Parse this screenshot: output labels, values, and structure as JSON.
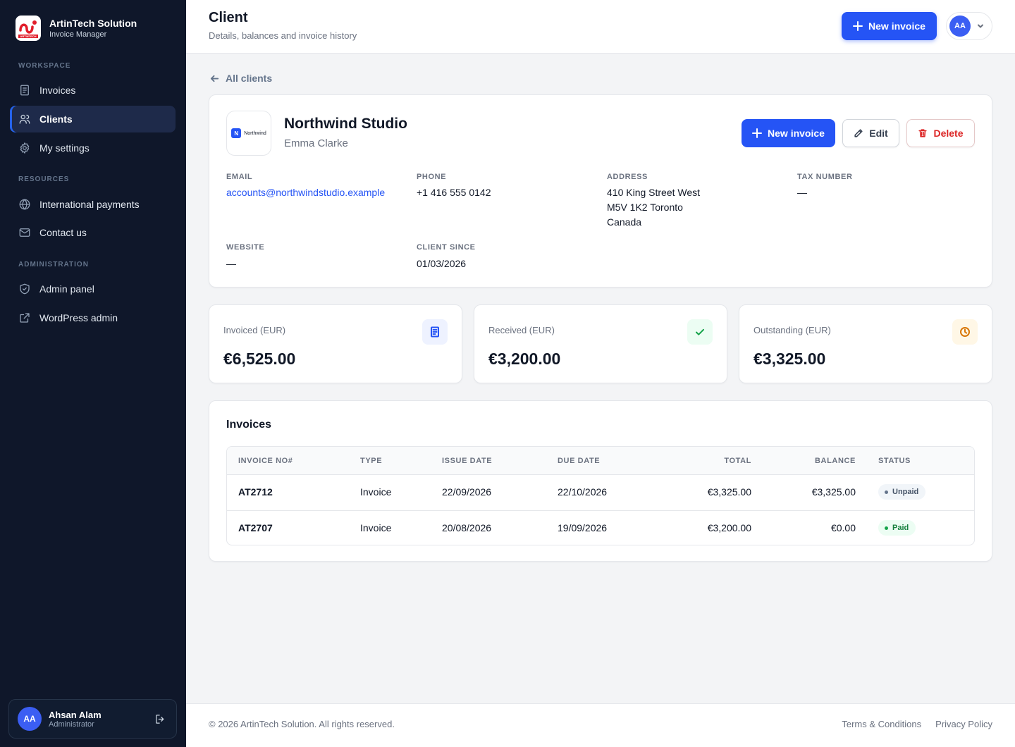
{
  "brand": {
    "name": "ArtinTech Solution",
    "subtitle": "Invoice Manager",
    "logo_text": "ARTINTECH"
  },
  "sidebar": {
    "sections": [
      "WORKSPACE",
      "RESOURCES",
      "ADMINISTRATION"
    ],
    "items": [
      {
        "label": "Invoices",
        "icon": "receipt-icon"
      },
      {
        "label": "Clients",
        "icon": "users-icon",
        "active": true
      },
      {
        "label": "My settings",
        "icon": "gear-icon"
      },
      {
        "label": "International payments",
        "icon": "globe-icon"
      },
      {
        "label": "Contact us",
        "icon": "mail-icon"
      },
      {
        "label": "Admin panel",
        "icon": "shield-icon"
      },
      {
        "label": "WordPress admin",
        "icon": "external-link-icon"
      }
    ],
    "user": {
      "initials": "AA",
      "name": "Ahsan Alam",
      "role": "Administrator"
    }
  },
  "header": {
    "title": "Client",
    "subtitle": "Details, balances and invoice history",
    "new_invoice_label": "New invoice",
    "avatar_initials": "AA"
  },
  "back_link": "All clients",
  "client": {
    "logo_letter": "N",
    "logo_word": "Northwind",
    "name": "Northwind Studio",
    "contact": "Emma Clarke",
    "actions": {
      "new_invoice": "New invoice",
      "edit": "Edit",
      "delete": "Delete"
    },
    "fields": {
      "email": {
        "label": "EMAIL",
        "value": "accounts@northwindstudio.example"
      },
      "phone": {
        "label": "PHONE",
        "value": "+1 416 555 0142"
      },
      "address": {
        "label": "ADDRESS",
        "lines": [
          "410 King Street West",
          "M5V 1K2 Toronto",
          "Canada"
        ]
      },
      "tax_number": {
        "label": "TAX NUMBER",
        "value": "—"
      },
      "website": {
        "label": "WEBSITE",
        "value": "—"
      },
      "client_since": {
        "label": "CLIENT SINCE",
        "value": "01/03/2026"
      }
    }
  },
  "stats": [
    {
      "label": "Invoiced (EUR)",
      "value": "€6,525.00",
      "icon": "document-icon",
      "color": "#2554f5",
      "bg": "#eef2ff"
    },
    {
      "label": "Received (EUR)",
      "value": "€3,200.00",
      "icon": "check-icon",
      "color": "#16a34a",
      "bg": "#ecfdf3"
    },
    {
      "label": "Outstanding (EUR)",
      "value": "€3,325.00",
      "icon": "clock-icon",
      "color": "#d97706",
      "bg": "#fff7e6"
    }
  ],
  "invoices": {
    "title": "Invoices",
    "columns": [
      "INVOICE NO#",
      "TYPE",
      "ISSUE DATE",
      "DUE DATE",
      "TOTAL",
      "BALANCE",
      "STATUS"
    ],
    "rows": [
      {
        "number": "AT2712",
        "type": "Invoice",
        "issue": "22/09/2026",
        "due": "22/10/2026",
        "total": "€3,325.00",
        "balance": "€3,325.00",
        "status": "Unpaid"
      },
      {
        "number": "AT2707",
        "type": "Invoice",
        "issue": "20/08/2026",
        "due": "19/09/2026",
        "total": "€3,200.00",
        "balance": "€0.00",
        "status": "Paid"
      }
    ],
    "status_colors": {
      "Unpaid": {
        "fg": "#475569",
        "bg": "#f1f5f9",
        "dot": "#64748b"
      },
      "Paid": {
        "fg": "#15803d",
        "bg": "#ecfdf3",
        "dot": "#16a34a"
      }
    }
  },
  "footer": {
    "copyright": "© 2026 ArtinTech Solution. All rights reserved.",
    "links": [
      "Terms & Conditions",
      "Privacy Policy"
    ]
  }
}
